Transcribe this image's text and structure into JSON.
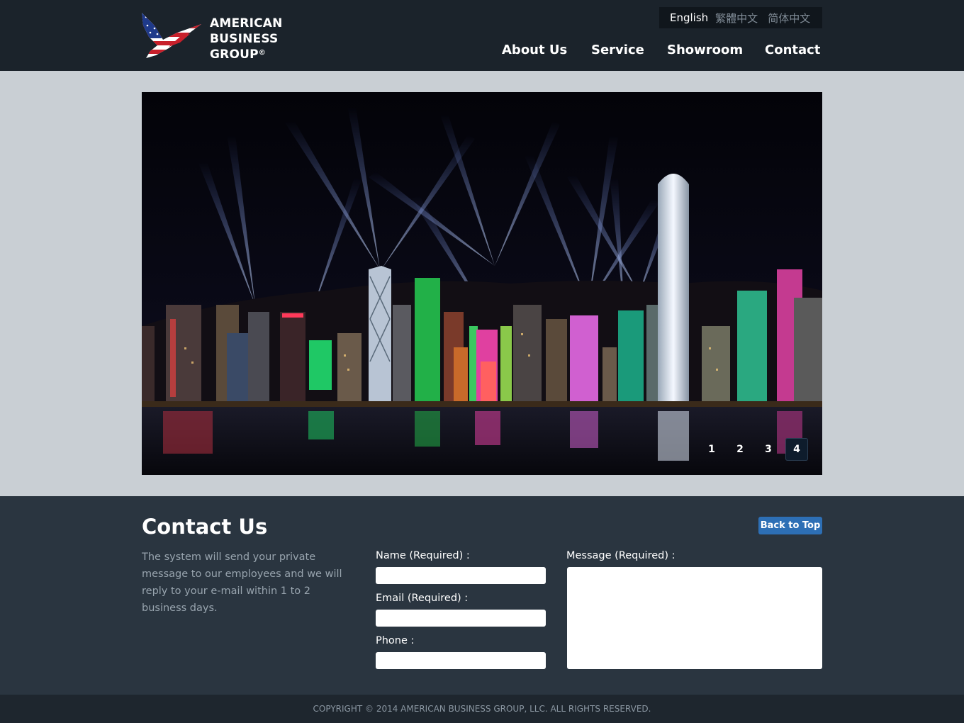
{
  "brand": {
    "line1": "AMERICAN",
    "line2": "BUSINESS",
    "line3": "GROUP",
    "mark": "©",
    "logo_icon": "eagle-flag-icon"
  },
  "languages": [
    {
      "label": "English",
      "active": true
    },
    {
      "label": "繁體中文",
      "active": false
    },
    {
      "label": "简体中文",
      "active": false
    }
  ],
  "nav": {
    "items": [
      {
        "label": "About Us"
      },
      {
        "label": "Service"
      },
      {
        "label": "Showroom"
      },
      {
        "label": "Contact"
      }
    ]
  },
  "slider": {
    "pages": [
      "1",
      "2",
      "3",
      "4"
    ],
    "active_page": "4"
  },
  "contact": {
    "title": "Contact Us",
    "back_to_top": "Back to Top",
    "description": "The system will send your private message to our employees and we will reply to your e-mail within 1 to 2 business days.",
    "name_label": "Name (Required) :",
    "email_label": "Email (Required) :",
    "phone_label": "Phone :",
    "message_label": "Message (Required) :"
  },
  "footer": {
    "copyright": "COPYRIGHT © 2014 AMERICAN BUSINESS GROUP, LLC. ALL RIGHTS RESERVED."
  }
}
